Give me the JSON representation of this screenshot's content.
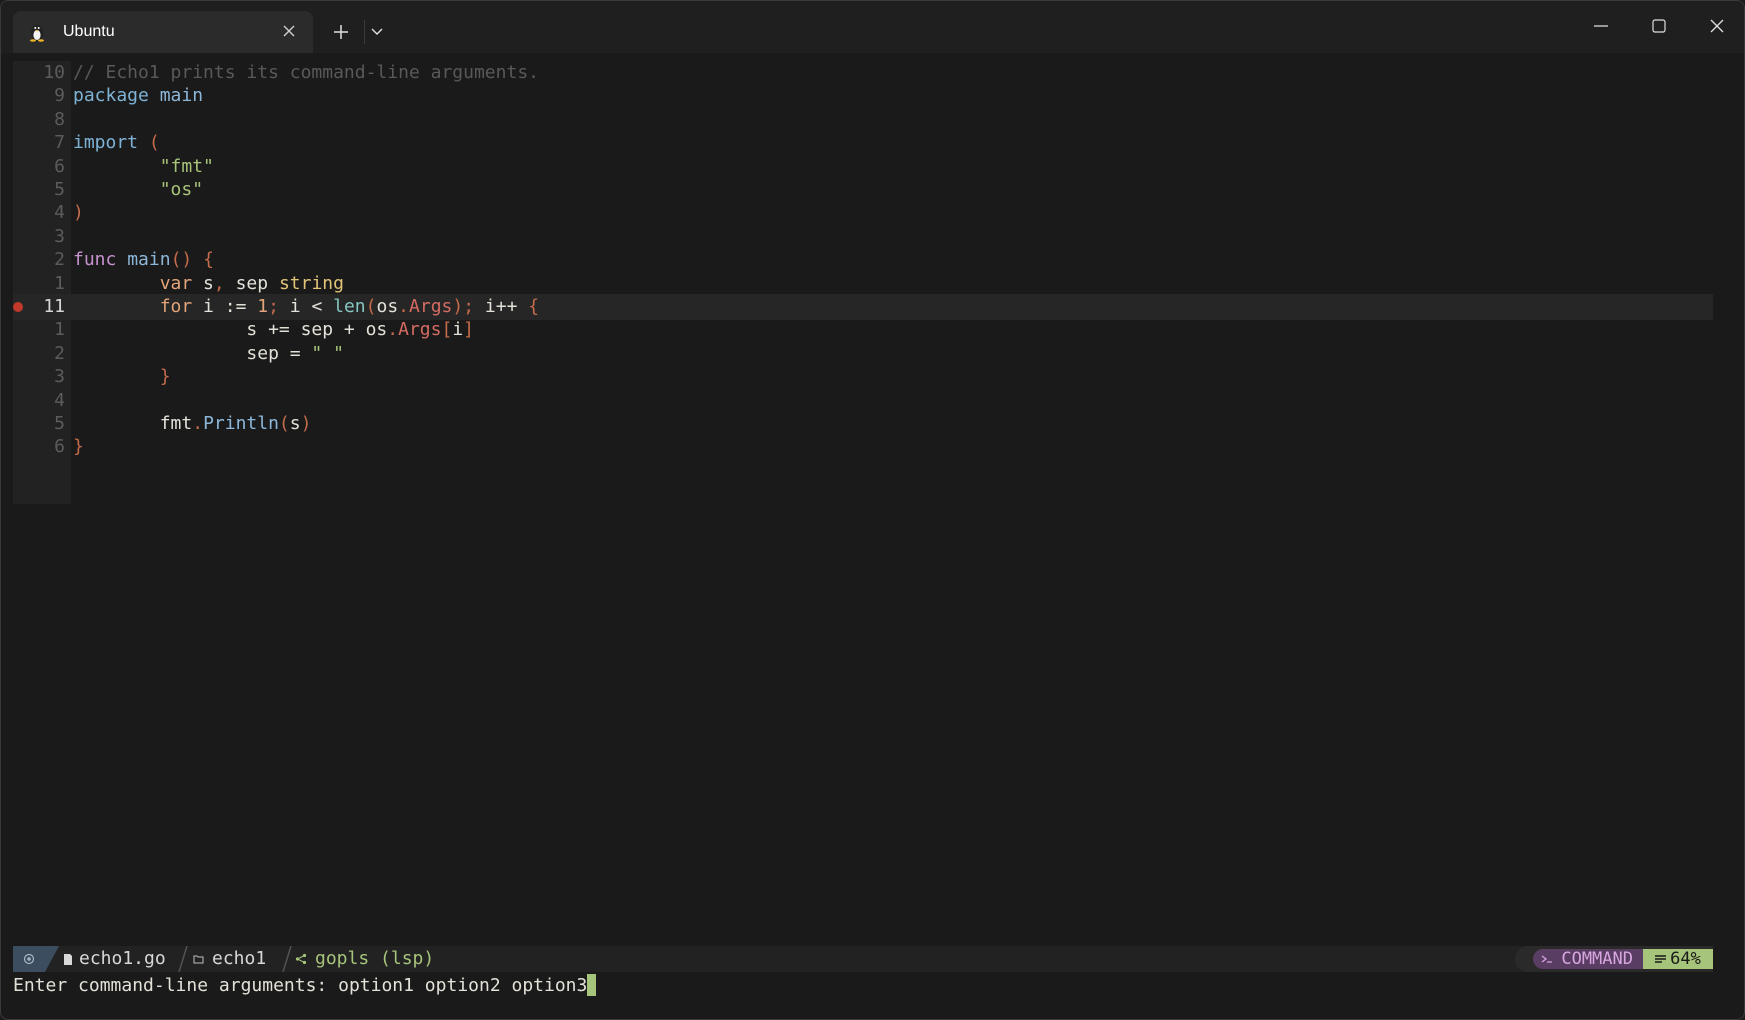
{
  "window": {
    "tab_title": "Ubuntu",
    "icons": {
      "tab": "linux-penguin-icon",
      "close_tab": "close-icon",
      "new_tab": "plus-icon",
      "dropdown": "chevron-down-icon",
      "minimize": "minimize-icon",
      "maximize": "maximize-icon",
      "close_window": "close-icon"
    }
  },
  "editor": {
    "lines": [
      {
        "num": "10",
        "tokens": [
          [
            "c-com",
            "// Echo1 prints its command-line arguments."
          ]
        ]
      },
      {
        "num": "9",
        "tokens": [
          [
            "c-kw1",
            "package"
          ],
          [
            "c-sym",
            " "
          ],
          [
            "c-fn",
            "main"
          ]
        ]
      },
      {
        "num": "8",
        "tokens": []
      },
      {
        "num": "7",
        "tokens": [
          [
            "c-kw1",
            "import"
          ],
          [
            "c-sym",
            " "
          ],
          [
            "c-br",
            "("
          ]
        ]
      },
      {
        "num": "6",
        "tokens": [
          [
            "c-sym",
            "        "
          ],
          [
            "c-str",
            "\"fmt\""
          ]
        ]
      },
      {
        "num": "5",
        "tokens": [
          [
            "c-sym",
            "        "
          ],
          [
            "c-str",
            "\"os\""
          ]
        ]
      },
      {
        "num": "4",
        "tokens": [
          [
            "c-br",
            ")"
          ]
        ]
      },
      {
        "num": "3",
        "tokens": []
      },
      {
        "num": "2",
        "tokens": [
          [
            "c-kw3",
            "func"
          ],
          [
            "c-sym",
            " "
          ],
          [
            "c-fn",
            "main"
          ],
          [
            "c-br",
            "()"
          ],
          [
            "c-sym",
            " "
          ],
          [
            "c-br",
            "{"
          ]
        ]
      },
      {
        "num": "1",
        "tokens": [
          [
            "c-sym",
            "        "
          ],
          [
            "c-kw2",
            "var"
          ],
          [
            "c-sym",
            " s"
          ],
          [
            "c-br",
            ","
          ],
          [
            "c-sym",
            " sep "
          ],
          [
            "c-typ",
            "string"
          ]
        ]
      },
      {
        "num": "11",
        "current": true,
        "breakpoint": true,
        "tokens": [
          [
            "c-sym",
            "        "
          ],
          [
            "c-kw2",
            "for"
          ],
          [
            "c-sym",
            " i := "
          ],
          [
            "c-num",
            "1"
          ],
          [
            "c-br",
            ";"
          ],
          [
            "c-sym",
            " i < "
          ],
          [
            "c-bi",
            "len"
          ],
          [
            "c-br",
            "("
          ],
          [
            "c-sym",
            "os"
          ],
          [
            "c-br",
            "."
          ],
          [
            "c-mem",
            "Args"
          ],
          [
            "c-br",
            ");"
          ],
          [
            "c-sym",
            " i++ "
          ],
          [
            "c-br",
            "{"
          ]
        ]
      },
      {
        "num": "1",
        "tokens": [
          [
            "c-sym",
            "                s += sep + os"
          ],
          [
            "c-br",
            "."
          ],
          [
            "c-mem",
            "Args"
          ],
          [
            "c-br",
            "["
          ],
          [
            "c-sym",
            "i"
          ],
          [
            "c-br",
            "]"
          ]
        ]
      },
      {
        "num": "2",
        "tokens": [
          [
            "c-sym",
            "                sep = "
          ],
          [
            "c-str",
            "\" \""
          ]
        ]
      },
      {
        "num": "3",
        "tokens": [
          [
            "c-sym",
            "        "
          ],
          [
            "c-br",
            "}"
          ]
        ]
      },
      {
        "num": "4",
        "tokens": []
      },
      {
        "num": "5",
        "tokens": [
          [
            "c-sym",
            "        fmt"
          ],
          [
            "c-br",
            "."
          ],
          [
            "c-fn",
            "Println"
          ],
          [
            "c-br",
            "("
          ],
          [
            "c-sym",
            "s"
          ],
          [
            "c-br",
            ")"
          ]
        ]
      },
      {
        "num": "6",
        "tokens": [
          [
            "c-br",
            "}"
          ]
        ]
      }
    ]
  },
  "statusline": {
    "file_name": "echo1.go",
    "folder": "echo1",
    "lsp": "gopls (lsp)",
    "mode": "COMMAND",
    "percent": "64%"
  },
  "cmdline": {
    "prompt": "Enter command-line arguments: ",
    "value": "option1 option2 option3"
  }
}
